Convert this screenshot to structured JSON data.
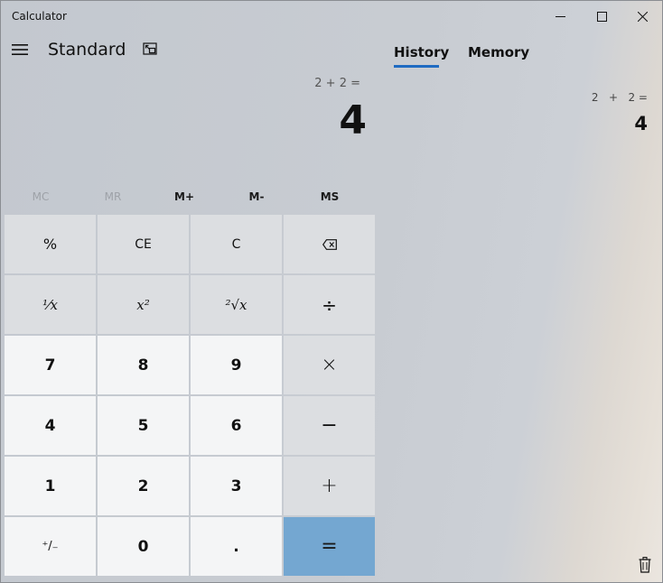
{
  "window": {
    "title": "Calculator"
  },
  "header": {
    "mode_title": "Standard"
  },
  "display": {
    "expression": "2 + 2 =",
    "result": "4"
  },
  "memory_buttons": [
    {
      "label": "MC",
      "enabled": false
    },
    {
      "label": "MR",
      "enabled": false
    },
    {
      "label": "M+",
      "enabled": true
    },
    {
      "label": "M-",
      "enabled": true
    },
    {
      "label": "MS",
      "enabled": true
    }
  ],
  "keys": {
    "percent": "%",
    "ce": "CE",
    "c": "C",
    "backspace_icon": "backspace-icon",
    "reciprocal": "⅟x",
    "square": "x²",
    "sqrt": "²√x",
    "divide": "÷",
    "multiply": "×",
    "minus": "−",
    "plus": "+",
    "equals": "=",
    "negate": "⁺/₋",
    "decimal": ".",
    "d0": "0",
    "d1": "1",
    "d2": "2",
    "d3": "3",
    "d4": "4",
    "d5": "5",
    "d6": "6",
    "d7": "7",
    "d8": "8",
    "d9": "9"
  },
  "side_panel": {
    "tabs": [
      {
        "label": "History",
        "active": true
      },
      {
        "label": "Memory",
        "active": false
      }
    ],
    "history": [
      {
        "expression": "2   +   2 =",
        "result": "4"
      }
    ]
  },
  "colors": {
    "accent": "#1f6bc2",
    "equals_key": "#74a7d1",
    "number_key": "#f4f5f6",
    "operator_key": "#dcdee1"
  },
  "icons": [
    "hamburger-icon",
    "keep-on-top-icon",
    "minimize-icon",
    "maximize-icon",
    "close-icon",
    "backspace-icon",
    "trash-icon"
  ]
}
